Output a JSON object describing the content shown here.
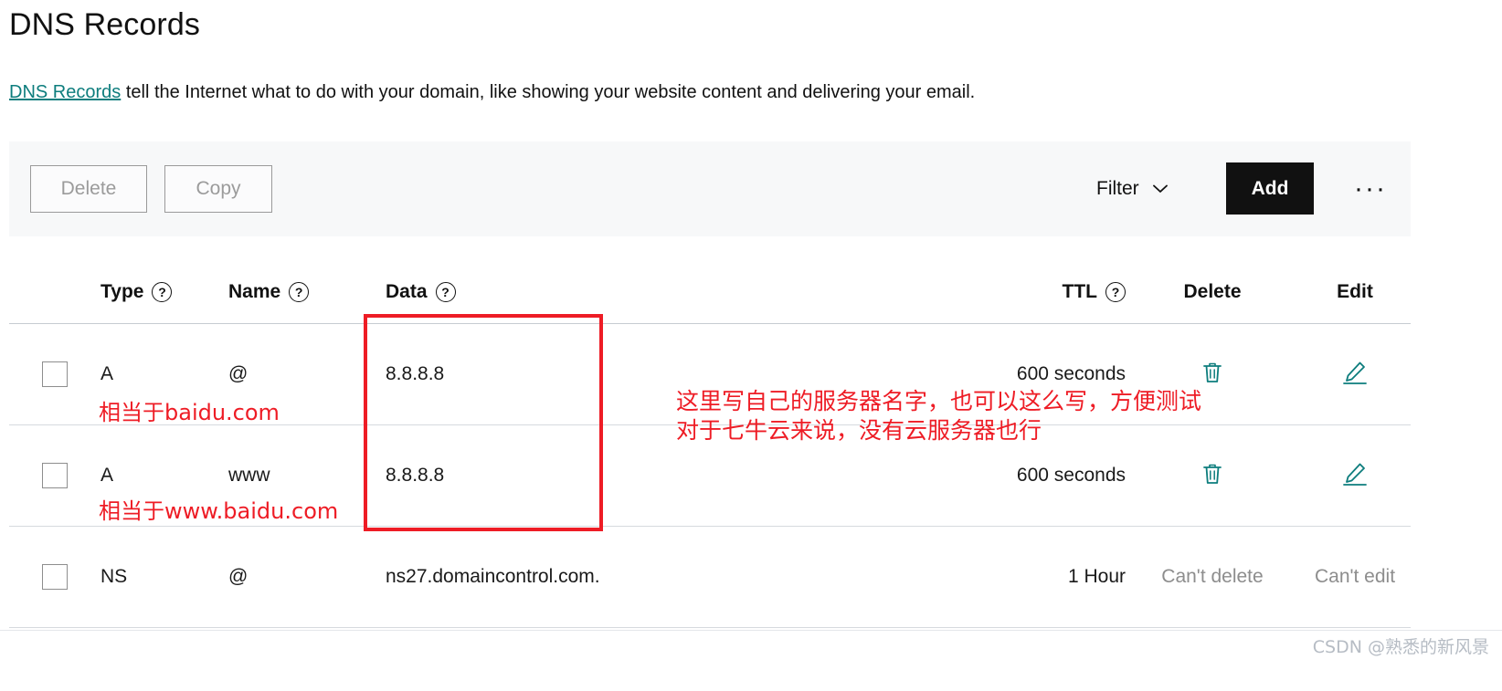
{
  "page": {
    "title": "DNS Records",
    "description_link": "DNS Records",
    "description_rest": " tell the Internet what to do with your domain, like showing your website content and delivering your email."
  },
  "toolbar": {
    "delete_label": "Delete",
    "copy_label": "Copy",
    "filter_label": "Filter",
    "add_label": "Add",
    "more_label": "···"
  },
  "table": {
    "headers": {
      "type": "Type",
      "name": "Name",
      "data": "Data",
      "ttl": "TTL",
      "delete": "Delete",
      "edit": "Edit",
      "help_glyph": "?"
    },
    "rows": [
      {
        "type": "A",
        "name": "@",
        "data": "8.8.8.8",
        "ttl": "600 seconds",
        "delete": "",
        "edit": "",
        "deletable": true,
        "editable": true
      },
      {
        "type": "A",
        "name": "www",
        "data": "8.8.8.8",
        "ttl": "600 seconds",
        "delete": "",
        "edit": "",
        "deletable": true,
        "editable": true
      },
      {
        "type": "NS",
        "name": "@",
        "data": "ns27.domaincontrol.com.",
        "ttl": "1 Hour",
        "delete": "Can't delete",
        "edit": "Can't edit",
        "deletable": false,
        "editable": false
      }
    ]
  },
  "annotations": {
    "baidu": "相当于baidu.com",
    "www_baidu": "相当于www.baidu.com",
    "right_line1": "这里写自己的服务器名字，也可以这么写，方便测试",
    "right_line2": "对于七牛云来说，没有云服务器也行"
  },
  "watermark": {
    "text": "CSDN @熟悉的新风景"
  },
  "colors": {
    "accent_teal": "#0d7d7d",
    "annotation_red": "#ee1c25",
    "add_button_bg": "#111111",
    "toolbar_bg": "#f7f8f9"
  }
}
